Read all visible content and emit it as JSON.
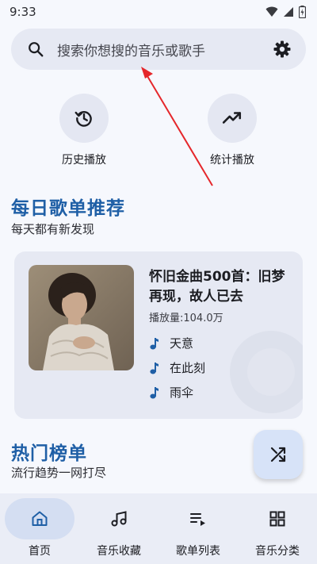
{
  "status_bar": {
    "time": "9:33"
  },
  "search": {
    "placeholder": "搜索你想搜的音乐或歌手"
  },
  "quick_actions": [
    {
      "label": "历史播放",
      "icon": "history-icon"
    },
    {
      "label": "统计播放",
      "icon": "trending-up-icon"
    }
  ],
  "daily": {
    "title": "每日歌单推荐",
    "subtitle": "每天都有新发现"
  },
  "playlist": {
    "title": "怀旧金曲500首：旧梦再现，故人已去",
    "playcount_label": "播放量:",
    "playcount_value": "104.0万",
    "songs": [
      "天意",
      "在此刻",
      "雨伞"
    ]
  },
  "charts": {
    "title": "热门榜单",
    "subtitle": "流行趋势一网打尽"
  },
  "bottom_nav": [
    {
      "label": "首页",
      "icon": "home-icon",
      "active": true
    },
    {
      "label": "音乐收藏",
      "icon": "music-note-icon",
      "active": false
    },
    {
      "label": "歌单列表",
      "icon": "playlist-icon",
      "active": false
    },
    {
      "label": "音乐分类",
      "icon": "grid-icon",
      "active": false
    }
  ],
  "colors": {
    "accent": "#1f5fa6",
    "annotation": "#e5272b"
  }
}
